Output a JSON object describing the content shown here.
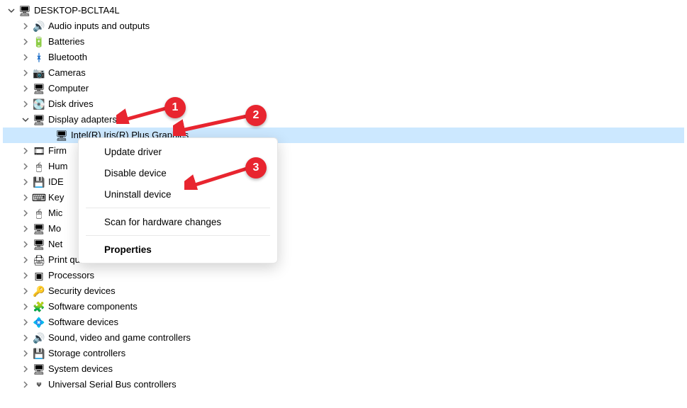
{
  "root": {
    "name": "DESKTOP-BCLTA4L"
  },
  "categories": [
    {
      "key": "audio",
      "label": "Audio inputs and outputs",
      "icon": "🔊"
    },
    {
      "key": "batteries",
      "label": "Batteries",
      "icon": "🔋"
    },
    {
      "key": "bluetooth",
      "label": "Bluetooth",
      "icon": "ᚼ"
    },
    {
      "key": "cameras",
      "label": "Cameras",
      "icon": "📷"
    },
    {
      "key": "computer",
      "label": "Computer",
      "icon": "🖥"
    },
    {
      "key": "diskdrives",
      "label": "Disk drives",
      "icon": "💽"
    },
    {
      "key": "display",
      "label": "Display adapters",
      "icon": "🖥",
      "expanded": true
    },
    {
      "key": "firmware",
      "label": "Firmware",
      "icon": "🎞"
    },
    {
      "key": "hid",
      "label": "Human Interface Devices",
      "icon": "🖱"
    },
    {
      "key": "ide",
      "label": "IDE ATA/ATAPI controllers",
      "icon": "💾"
    },
    {
      "key": "keyboards",
      "label": "Keyboards",
      "icon": "⌨"
    },
    {
      "key": "mice",
      "label": "Mice and other pointing devices",
      "icon": "🖱"
    },
    {
      "key": "monitors",
      "label": "Monitors",
      "icon": "🖥"
    },
    {
      "key": "network",
      "label": "Network adapters",
      "icon": "🖥"
    },
    {
      "key": "printq",
      "label": "Print queues",
      "icon": "🖨"
    },
    {
      "key": "processors",
      "label": "Processors",
      "icon": "▣"
    },
    {
      "key": "security",
      "label": "Security devices",
      "icon": "🔑"
    },
    {
      "key": "softcomp",
      "label": "Software components",
      "icon": "🧩"
    },
    {
      "key": "softdev",
      "label": "Software devices",
      "icon": "💠"
    },
    {
      "key": "sound",
      "label": "Sound, video and game controllers",
      "icon": "🔊"
    },
    {
      "key": "storage",
      "label": "Storage controllers",
      "icon": "💾"
    },
    {
      "key": "system",
      "label": "System devices",
      "icon": "🖥"
    },
    {
      "key": "usb",
      "label": "Universal Serial Bus controllers",
      "icon": "USB"
    }
  ],
  "display_child": {
    "label": "Intel(R) Iris(R) Plus Graphics"
  },
  "truncated_labels": {
    "firmware": "Firm",
    "hid": "Hum",
    "ide": "IDE",
    "keyboards": "Key",
    "mice": "Mic",
    "monitors": "Mo",
    "network": "Net"
  },
  "context_menu": {
    "update": "Update driver",
    "disable": "Disable device",
    "uninstall": "Uninstall device",
    "scan": "Scan for hardware changes",
    "props": "Properties"
  },
  "annotations": {
    "1": "1",
    "2": "2",
    "3": "3"
  }
}
